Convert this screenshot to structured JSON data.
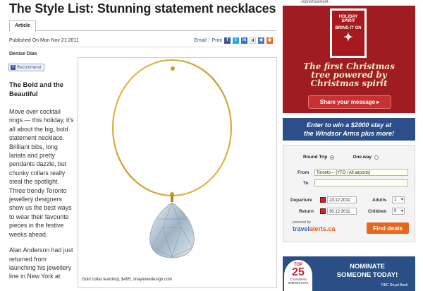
{
  "article": {
    "title": "The Style List: Stunning statement necklaces",
    "tab_label": "Article",
    "published": "Published On Mon Nov 21 2011",
    "tools": {
      "email": "Email",
      "print": "Print"
    },
    "author": "Denise Dias",
    "recommend_label": "Recommend",
    "subhead": "The Bold and the Beautiful",
    "paragraphs": [
      "Move over cocktail rings — this holiday, it's all about the big, bold statement necklace. Brilliant bibs, long lariats and pretty pendants dazzle, but chunky collars really steal the spotlight. Three trendy Toronto jewellery designers show us the best ways to wear their favourite pieces in the festive weeks ahead.",
      "Alan Anderson had just returned from launching his jewellery line in New York at"
    ],
    "caption": "Gold collar teardrop, $495, shaylowedesign.com"
  },
  "ads": {
    "label": "- Advertisement -",
    "holiday_badge": [
      "HOLIDAY",
      "SPIRIT",
      "BRING IT ON"
    ],
    "holiday_text": [
      "The first Christmas",
      "tree powered by",
      "Christmas spirit"
    ],
    "share_button": "Share your message ▸",
    "contest_text": [
      "Enter to win a $2000 stay at",
      "the Windsor Arms plus more!"
    ],
    "nominate_text": [
      "NOMINATE",
      "SOMEONE TODAY!"
    ],
    "top25": [
      "TOP",
      "25",
      "CANADIAN",
      "IMMIGRANTS"
    ],
    "sponsor": "RBC Royal Bank"
  },
  "travel_widget": {
    "round_trip": "Round Trip",
    "one_way": "One way",
    "from_label": "From",
    "from_value": "Toronto -- [YTO / All airports]",
    "to_label": "To",
    "to_value": "",
    "departure_label": "Departure",
    "departure_value": "23.12.2011",
    "return_label": "Return",
    "return_value": "30.12.2011",
    "adults_label": "Adults",
    "adults_value": "1",
    "children_label": "Children",
    "children_value": "0",
    "powered_by": "powered by",
    "brand_main": "travel",
    "brand_accent": "alerts.ca",
    "find_button": "Find deals"
  },
  "colors": {
    "ad_red": "#9f1d22",
    "ad_blue": "#2c4e8a",
    "find_orange": "#e8661a",
    "link_blue": "#1a4f9c"
  }
}
